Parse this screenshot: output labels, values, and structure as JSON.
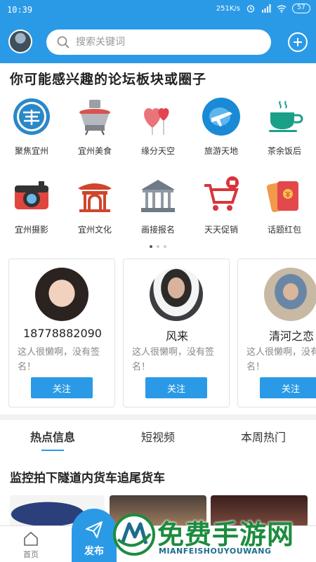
{
  "status_bar": {
    "time": "10:39",
    "speed": "251K/s",
    "battery": "57"
  },
  "search": {
    "placeholder": "搜索关键词"
  },
  "section_title": "你可能感兴趣的论坛板块或圈子",
  "categories": [
    {
      "label": "聚焦宜州",
      "icon": "focus-yizhou-icon"
    },
    {
      "label": "宜州美食",
      "icon": "hotpot-icon"
    },
    {
      "label": "缘分天空",
      "icon": "hearts-icon"
    },
    {
      "label": "旅游天地",
      "icon": "travel-plane-icon"
    },
    {
      "label": "茶余饭后",
      "icon": "tea-cup-icon"
    },
    {
      "label": "宜州摄影",
      "icon": "camera-icon"
    },
    {
      "label": "宜州文化",
      "icon": "pavilion-icon"
    },
    {
      "label": "画接报名",
      "icon": "building-icon"
    },
    {
      "label": "天天促销",
      "icon": "shopping-cart-icon"
    },
    {
      "label": "话题红包",
      "icon": "red-envelope-icon"
    }
  ],
  "users": [
    {
      "name": "18778882090",
      "bio": "这人很懒啊，没有签名！",
      "follow": "关注"
    },
    {
      "name": "风来",
      "bio": "这人很懒啊，没有签名！",
      "follow": "关注"
    },
    {
      "name": "清河之恋",
      "bio": "这人很懒啊，没有签名！",
      "follow": "关注"
    }
  ],
  "tabs": [
    "热点信息",
    "短视频",
    "本周热门"
  ],
  "headline": "监控拍下隧道内货车追尾货车",
  "bottom_nav": {
    "home": "首页",
    "publish": "发布"
  },
  "watermark": {
    "title": "免费手游网",
    "subtitle": "MIANFEISHOUYOUWANG"
  },
  "colors": {
    "accent": "#2b9ae6",
    "watermark": "#1c8c3e"
  }
}
